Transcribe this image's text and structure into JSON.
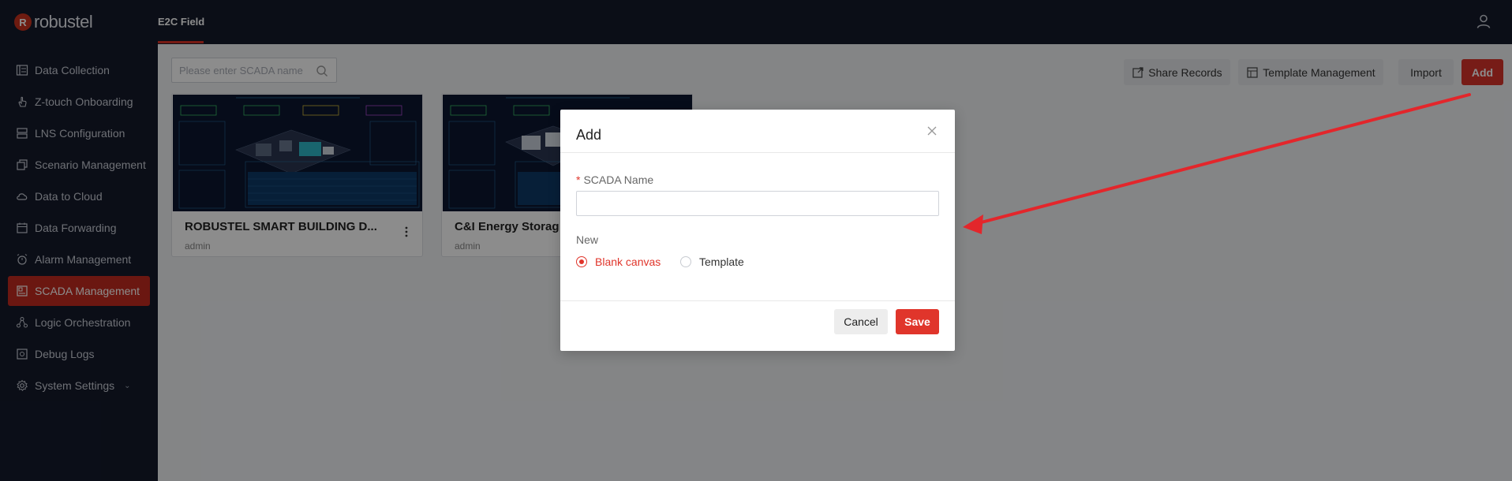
{
  "app": {
    "brand": "robustel",
    "logo_letter": "R"
  },
  "topbar": {
    "tab_label": "E2C Field"
  },
  "sidebar": {
    "items": [
      {
        "label": "Data Collection",
        "icon": "data-collection-icon"
      },
      {
        "label": "Z-touch Onboarding",
        "icon": "hand-icon"
      },
      {
        "label": "LNS Configuration",
        "icon": "server-icon"
      },
      {
        "label": "Scenario Management",
        "icon": "layers-icon"
      },
      {
        "label": "Data to Cloud",
        "icon": "cloud-icon"
      },
      {
        "label": "Data Forwarding",
        "icon": "calendar-icon"
      },
      {
        "label": "Alarm Management",
        "icon": "alarm-icon"
      },
      {
        "label": "SCADA Management",
        "icon": "scada-icon"
      },
      {
        "label": "Logic Orchestration",
        "icon": "nodes-icon"
      },
      {
        "label": "Debug Logs",
        "icon": "debug-icon"
      },
      {
        "label": "System Settings",
        "icon": "gear-icon"
      }
    ]
  },
  "toolbar": {
    "search_placeholder": "Please enter SCADA name",
    "share_label": "Share Records",
    "template_label": "Template Management",
    "import_label": "Import",
    "add_label": "Add"
  },
  "cards": [
    {
      "title": "ROBUSTEL SMART BUILDING D...",
      "owner": "admin"
    },
    {
      "title": "C&I Energy Storag",
      "owner": "admin"
    }
  ],
  "modal": {
    "title": "Add",
    "field_label": "SCADA Name",
    "required_mark": "*",
    "field_value": "",
    "new_label": "New",
    "option_blank": "Blank canvas",
    "option_template": "Template",
    "cancel_label": "Cancel",
    "save_label": "Save"
  },
  "colors": {
    "accent": "#d9342b",
    "sidebar_bg": "#141a2b",
    "annotation_arrow": "#e3262b"
  }
}
